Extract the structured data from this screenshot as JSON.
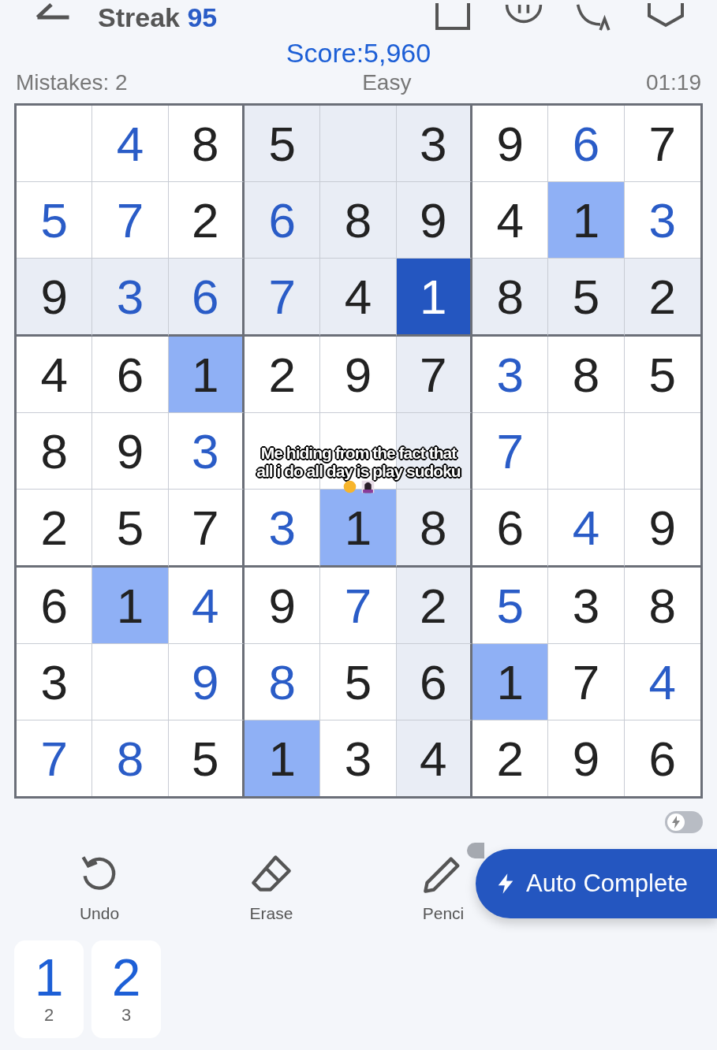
{
  "top_bar": {
    "streak_label": "Streak",
    "streak_value": "95"
  },
  "score": {
    "label": "Score:",
    "value": "5,960"
  },
  "info": {
    "mistakes": "Mistakes: 2",
    "difficulty": "Easy",
    "timer": "01:19"
  },
  "grid": {
    "rows": [
      {
        "cells": [
          {
            "selected": false,
            "related": false,
            "matching": false
          },
          {
            "value": "4",
            "given": false,
            "selected": false,
            "related": false,
            "matching": false
          },
          {
            "value": "8",
            "given": true,
            "selected": false,
            "related": false,
            "matching": false
          },
          {
            "value": "5",
            "given": true,
            "selected": false,
            "related": true,
            "matching": false
          },
          {
            "selected": false,
            "related": true,
            "matching": false
          },
          {
            "value": "3",
            "given": true,
            "selected": false,
            "related": true,
            "matching": false
          },
          {
            "value": "9",
            "given": true,
            "selected": false,
            "related": false,
            "matching": false
          },
          {
            "value": "6",
            "given": false,
            "selected": false,
            "related": false,
            "matching": false
          },
          {
            "value": "7",
            "given": true,
            "selected": false,
            "related": false,
            "matching": false
          }
        ]
      },
      {
        "cells": [
          {
            "value": "5",
            "given": false,
            "selected": false,
            "related": false,
            "matching": false
          },
          {
            "value": "7",
            "given": false,
            "selected": false,
            "related": false,
            "matching": false
          },
          {
            "value": "2",
            "given": true,
            "selected": false,
            "related": false,
            "matching": false
          },
          {
            "value": "6",
            "given": false,
            "selected": false,
            "related": true,
            "matching": false
          },
          {
            "value": "8",
            "given": true,
            "selected": false,
            "related": true,
            "matching": false
          },
          {
            "value": "9",
            "given": true,
            "selected": false,
            "related": true,
            "matching": false
          },
          {
            "value": "4",
            "given": true,
            "selected": false,
            "related": false,
            "matching": false
          },
          {
            "value": "1",
            "given": true,
            "selected": false,
            "related": false,
            "matching": true
          },
          {
            "value": "3",
            "given": false,
            "selected": false,
            "related": false,
            "matching": false
          }
        ]
      },
      {
        "cells": [
          {
            "value": "9",
            "given": true,
            "selected": false,
            "related": true,
            "matching": false
          },
          {
            "value": "3",
            "given": false,
            "selected": false,
            "related": true,
            "matching": false
          },
          {
            "value": "6",
            "given": false,
            "selected": false,
            "related": true,
            "matching": false
          },
          {
            "value": "7",
            "given": false,
            "selected": false,
            "related": true,
            "matching": false
          },
          {
            "value": "4",
            "given": true,
            "selected": false,
            "related": true,
            "matching": false
          },
          {
            "value": "1",
            "given": true,
            "selected": true,
            "related": false,
            "matching": false
          },
          {
            "value": "8",
            "given": true,
            "selected": false,
            "related": true,
            "matching": false
          },
          {
            "value": "5",
            "given": true,
            "selected": false,
            "related": true,
            "matching": false
          },
          {
            "value": "2",
            "given": true,
            "selected": false,
            "related": true,
            "matching": false
          }
        ]
      },
      {
        "cells": [
          {
            "value": "4",
            "given": true,
            "selected": false,
            "related": false,
            "matching": false
          },
          {
            "value": "6",
            "given": true,
            "selected": false,
            "related": false,
            "matching": false
          },
          {
            "value": "1",
            "given": true,
            "selected": false,
            "related": false,
            "matching": true
          },
          {
            "value": "2",
            "given": true,
            "selected": false,
            "related": false,
            "matching": false
          },
          {
            "value": "9",
            "given": true,
            "selected": false,
            "related": false,
            "matching": false
          },
          {
            "value": "7",
            "given": true,
            "selected": false,
            "related": true,
            "matching": false
          },
          {
            "value": "3",
            "given": false,
            "selected": false,
            "related": false,
            "matching": false
          },
          {
            "value": "8",
            "given": true,
            "selected": false,
            "related": false,
            "matching": false
          },
          {
            "value": "5",
            "given": true,
            "selected": false,
            "related": false,
            "matching": false
          }
        ]
      },
      {
        "cells": [
          {
            "value": "8",
            "given": true,
            "selected": false,
            "related": false,
            "matching": false
          },
          {
            "value": "9",
            "given": true,
            "selected": false,
            "related": false,
            "matching": false
          },
          {
            "value": "3",
            "given": false,
            "selected": false,
            "related": false,
            "matching": false
          },
          {
            "selected": false,
            "related": false,
            "matching": false
          },
          {
            "selected": false,
            "related": false,
            "matching": false
          },
          {
            "selected": false,
            "related": true,
            "matching": false
          },
          {
            "value": "7",
            "given": false,
            "selected": false,
            "related": false,
            "matching": false
          },
          {
            "selected": false,
            "related": false,
            "matching": false
          },
          {
            "selected": false,
            "related": false,
            "matching": false
          }
        ]
      },
      {
        "cells": [
          {
            "value": "2",
            "given": true,
            "selected": false,
            "related": false,
            "matching": false
          },
          {
            "value": "5",
            "given": true,
            "selected": false,
            "related": false,
            "matching": false
          },
          {
            "value": "7",
            "given": true,
            "selected": false,
            "related": false,
            "matching": false
          },
          {
            "value": "3",
            "given": false,
            "selected": false,
            "related": false,
            "matching": false
          },
          {
            "value": "1",
            "given": true,
            "selected": false,
            "related": false,
            "matching": true
          },
          {
            "value": "8",
            "given": true,
            "selected": false,
            "related": true,
            "matching": false
          },
          {
            "value": "6",
            "given": true,
            "selected": false,
            "related": false,
            "matching": false
          },
          {
            "value": "4",
            "given": false,
            "selected": false,
            "related": false,
            "matching": false
          },
          {
            "value": "9",
            "given": true,
            "selected": false,
            "related": false,
            "matching": false
          }
        ]
      },
      {
        "cells": [
          {
            "value": "6",
            "given": true,
            "selected": false,
            "related": false,
            "matching": false
          },
          {
            "value": "1",
            "given": true,
            "selected": false,
            "related": false,
            "matching": true
          },
          {
            "value": "4",
            "given": false,
            "selected": false,
            "related": false,
            "matching": false
          },
          {
            "value": "9",
            "given": true,
            "selected": false,
            "related": false,
            "matching": false
          },
          {
            "value": "7",
            "given": false,
            "selected": false,
            "related": false,
            "matching": false
          },
          {
            "value": "2",
            "given": true,
            "selected": false,
            "related": true,
            "matching": false
          },
          {
            "value": "5",
            "given": false,
            "selected": false,
            "related": false,
            "matching": false
          },
          {
            "value": "3",
            "given": true,
            "selected": false,
            "related": false,
            "matching": false
          },
          {
            "value": "8",
            "given": true,
            "selected": false,
            "related": false,
            "matching": false
          }
        ]
      },
      {
        "cells": [
          {
            "value": "3",
            "given": true,
            "selected": false,
            "related": false,
            "matching": false
          },
          {
            "selected": false,
            "related": false,
            "matching": false
          },
          {
            "value": "9",
            "given": false,
            "selected": false,
            "related": false,
            "matching": false
          },
          {
            "value": "8",
            "given": false,
            "selected": false,
            "related": false,
            "matching": false
          },
          {
            "value": "5",
            "given": true,
            "selected": false,
            "related": false,
            "matching": false
          },
          {
            "value": "6",
            "given": true,
            "selected": false,
            "related": true,
            "matching": false
          },
          {
            "value": "1",
            "given": true,
            "selected": false,
            "related": false,
            "matching": true
          },
          {
            "value": "7",
            "given": true,
            "selected": false,
            "related": false,
            "matching": false
          },
          {
            "value": "4",
            "given": false,
            "selected": false,
            "related": false,
            "matching": false
          }
        ]
      },
      {
        "cells": [
          {
            "value": "7",
            "given": false,
            "selected": false,
            "related": false,
            "matching": false
          },
          {
            "value": "8",
            "given": false,
            "selected": false,
            "related": false,
            "matching": false
          },
          {
            "value": "5",
            "given": true,
            "selected": false,
            "related": false,
            "matching": false
          },
          {
            "value": "1",
            "given": true,
            "selected": false,
            "related": false,
            "matching": true
          },
          {
            "value": "3",
            "given": true,
            "selected": false,
            "related": false,
            "matching": false
          },
          {
            "value": "4",
            "given": true,
            "selected": false,
            "related": true,
            "matching": false
          },
          {
            "value": "2",
            "given": true,
            "selected": false,
            "related": false,
            "matching": false
          },
          {
            "value": "9",
            "given": true,
            "selected": false,
            "related": false,
            "matching": false
          },
          {
            "value": "6",
            "given": true,
            "selected": false,
            "related": false,
            "matching": false
          }
        ]
      }
    ]
  },
  "caption": {
    "lines": [
      "Me hiding from the fact that",
      "all i do all day is play sudoku"
    ]
  },
  "fast_mode_toggle": {
    "on": false
  },
  "actions": [
    {
      "kind": "undo",
      "label": "Undo"
    },
    {
      "kind": "erase",
      "label": "Erase"
    },
    {
      "kind": "pencil",
      "label": "Penci"
    }
  ],
  "auto_complete": {
    "label": "Auto Complete"
  },
  "remaining": [
    {
      "digit": "1",
      "count": "2"
    },
    {
      "digit": "2",
      "count": "3"
    }
  ]
}
